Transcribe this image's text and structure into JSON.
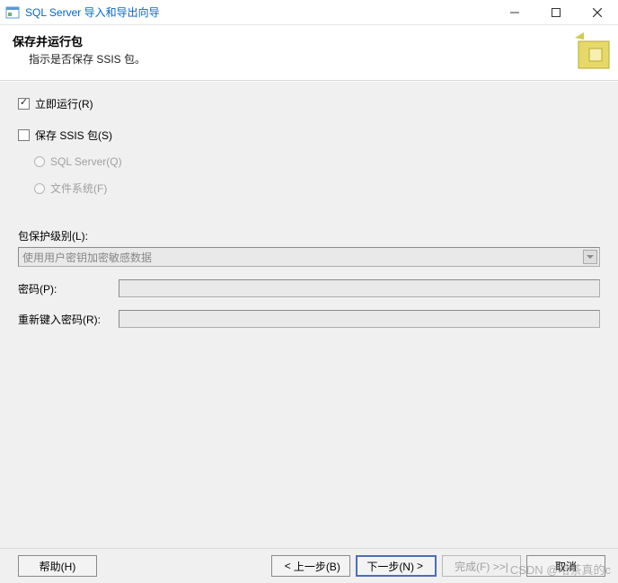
{
  "window": {
    "title": "SQL Server 导入和导出向导"
  },
  "header": {
    "title": "保存并运行包",
    "subtitle": "指示是否保存 SSIS 包。"
  },
  "options": {
    "run_now": {
      "label": "立即运行(R)",
      "checked": true
    },
    "save_ssis": {
      "label": "保存 SSIS 包(S)",
      "checked": false
    },
    "target_sql": {
      "label": "SQL Server(Q)"
    },
    "target_file": {
      "label": "文件系统(F)"
    }
  },
  "protection": {
    "label": "包保护级别(L):",
    "value": "使用用户密钥加密敏感数据"
  },
  "password": {
    "label": "密码(P):",
    "retype_label": "重新键入密码(R):"
  },
  "footer": {
    "help": "帮助(H)",
    "back": "上一步(B)",
    "next": "下一步(N)",
    "finish": "完成(F) >>|",
    "cancel": "取消"
  },
  "watermark": "CSDN @哈茶真的c"
}
